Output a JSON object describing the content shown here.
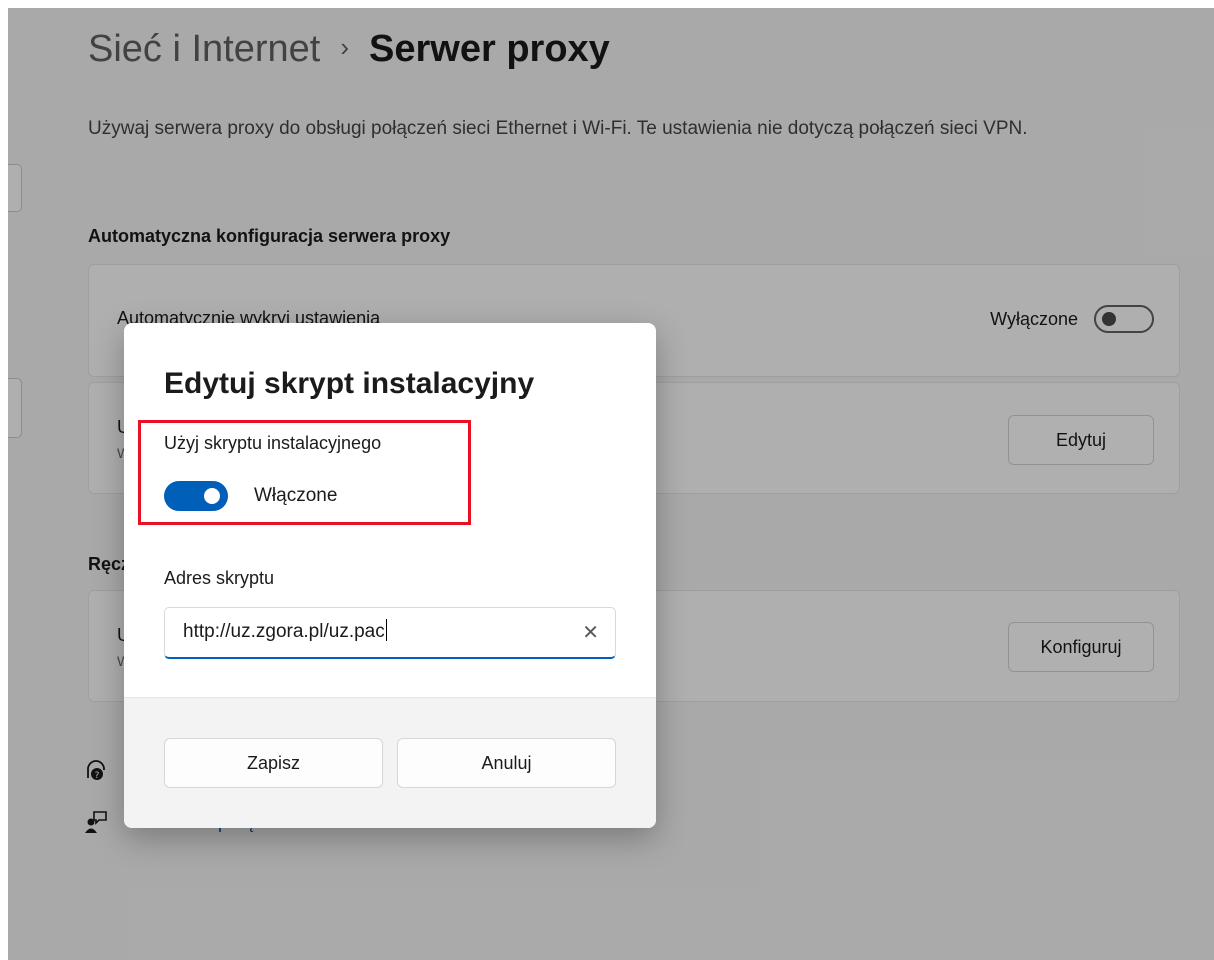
{
  "header": {
    "parent": "Sieć i Internet",
    "separator": "›",
    "current": "Serwer proxy"
  },
  "description": "Używaj serwera proxy do obsługi połączeń sieci Ethernet i Wi-Fi. Te ustawienia nie dotyczą połączeń sieci VPN.",
  "auto_section": {
    "title": "Automatyczna konfiguracja serwera proxy",
    "detect": {
      "label": "Automatycznie wykryj ustawienia",
      "toggle_state": "Wyłączone",
      "toggle_on": false
    },
    "script": {
      "label": "U",
      "sub": "W",
      "button": "Edytuj"
    }
  },
  "manual_section": {
    "title": "Ręcz",
    "proxy": {
      "label": "U",
      "sub": "W",
      "button": "Konfiguruj"
    }
  },
  "links": [
    {
      "icon": "help-icon",
      "label": ""
    },
    {
      "icon": "feedback-icon",
      "label": "Przekaż opinię"
    }
  ],
  "dialog": {
    "title": "Edytuj skrypt instalacyjny",
    "use_script_label": "Użyj skryptu instalacyjnego",
    "toggle_state": "Włączone",
    "toggle_on": true,
    "address_label": "Adres skryptu",
    "address_value": "http://uz.zgora.pl/uz.pac",
    "save_button": "Zapisz",
    "cancel_button": "Anuluj",
    "highlight_color": "#e81123"
  },
  "colors": {
    "accent": "#005fb8",
    "link": "#0055a5"
  }
}
